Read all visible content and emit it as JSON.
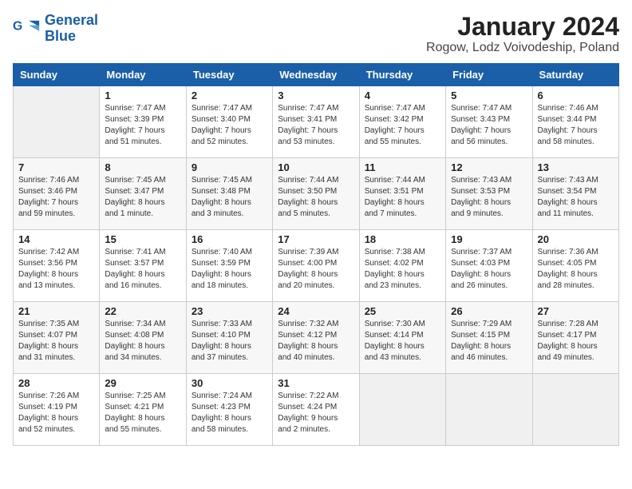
{
  "logo": {
    "line1": "General",
    "line2": "Blue"
  },
  "title": "January 2024",
  "subtitle": "Rogow, Lodz Voivodeship, Poland",
  "days_of_week": [
    "Sunday",
    "Monday",
    "Tuesday",
    "Wednesday",
    "Thursday",
    "Friday",
    "Saturday"
  ],
  "weeks": [
    [
      {
        "day": "",
        "info": ""
      },
      {
        "day": "1",
        "info": "Sunrise: 7:47 AM\nSunset: 3:39 PM\nDaylight: 7 hours\nand 51 minutes."
      },
      {
        "day": "2",
        "info": "Sunrise: 7:47 AM\nSunset: 3:40 PM\nDaylight: 7 hours\nand 52 minutes."
      },
      {
        "day": "3",
        "info": "Sunrise: 7:47 AM\nSunset: 3:41 PM\nDaylight: 7 hours\nand 53 minutes."
      },
      {
        "day": "4",
        "info": "Sunrise: 7:47 AM\nSunset: 3:42 PM\nDaylight: 7 hours\nand 55 minutes."
      },
      {
        "day": "5",
        "info": "Sunrise: 7:47 AM\nSunset: 3:43 PM\nDaylight: 7 hours\nand 56 minutes."
      },
      {
        "day": "6",
        "info": "Sunrise: 7:46 AM\nSunset: 3:44 PM\nDaylight: 7 hours\nand 58 minutes."
      }
    ],
    [
      {
        "day": "7",
        "info": "Sunrise: 7:46 AM\nSunset: 3:46 PM\nDaylight: 7 hours\nand 59 minutes."
      },
      {
        "day": "8",
        "info": "Sunrise: 7:45 AM\nSunset: 3:47 PM\nDaylight: 8 hours\nand 1 minute."
      },
      {
        "day": "9",
        "info": "Sunrise: 7:45 AM\nSunset: 3:48 PM\nDaylight: 8 hours\nand 3 minutes."
      },
      {
        "day": "10",
        "info": "Sunrise: 7:44 AM\nSunset: 3:50 PM\nDaylight: 8 hours\nand 5 minutes."
      },
      {
        "day": "11",
        "info": "Sunrise: 7:44 AM\nSunset: 3:51 PM\nDaylight: 8 hours\nand 7 minutes."
      },
      {
        "day": "12",
        "info": "Sunrise: 7:43 AM\nSunset: 3:53 PM\nDaylight: 8 hours\nand 9 minutes."
      },
      {
        "day": "13",
        "info": "Sunrise: 7:43 AM\nSunset: 3:54 PM\nDaylight: 8 hours\nand 11 minutes."
      }
    ],
    [
      {
        "day": "14",
        "info": "Sunrise: 7:42 AM\nSunset: 3:56 PM\nDaylight: 8 hours\nand 13 minutes."
      },
      {
        "day": "15",
        "info": "Sunrise: 7:41 AM\nSunset: 3:57 PM\nDaylight: 8 hours\nand 16 minutes."
      },
      {
        "day": "16",
        "info": "Sunrise: 7:40 AM\nSunset: 3:59 PM\nDaylight: 8 hours\nand 18 minutes."
      },
      {
        "day": "17",
        "info": "Sunrise: 7:39 AM\nSunset: 4:00 PM\nDaylight: 8 hours\nand 20 minutes."
      },
      {
        "day": "18",
        "info": "Sunrise: 7:38 AM\nSunset: 4:02 PM\nDaylight: 8 hours\nand 23 minutes."
      },
      {
        "day": "19",
        "info": "Sunrise: 7:37 AM\nSunset: 4:03 PM\nDaylight: 8 hours\nand 26 minutes."
      },
      {
        "day": "20",
        "info": "Sunrise: 7:36 AM\nSunset: 4:05 PM\nDaylight: 8 hours\nand 28 minutes."
      }
    ],
    [
      {
        "day": "21",
        "info": "Sunrise: 7:35 AM\nSunset: 4:07 PM\nDaylight: 8 hours\nand 31 minutes."
      },
      {
        "day": "22",
        "info": "Sunrise: 7:34 AM\nSunset: 4:08 PM\nDaylight: 8 hours\nand 34 minutes."
      },
      {
        "day": "23",
        "info": "Sunrise: 7:33 AM\nSunset: 4:10 PM\nDaylight: 8 hours\nand 37 minutes."
      },
      {
        "day": "24",
        "info": "Sunrise: 7:32 AM\nSunset: 4:12 PM\nDaylight: 8 hours\nand 40 minutes."
      },
      {
        "day": "25",
        "info": "Sunrise: 7:30 AM\nSunset: 4:14 PM\nDaylight: 8 hours\nand 43 minutes."
      },
      {
        "day": "26",
        "info": "Sunrise: 7:29 AM\nSunset: 4:15 PM\nDaylight: 8 hours\nand 46 minutes."
      },
      {
        "day": "27",
        "info": "Sunrise: 7:28 AM\nSunset: 4:17 PM\nDaylight: 8 hours\nand 49 minutes."
      }
    ],
    [
      {
        "day": "28",
        "info": "Sunrise: 7:26 AM\nSunset: 4:19 PM\nDaylight: 8 hours\nand 52 minutes."
      },
      {
        "day": "29",
        "info": "Sunrise: 7:25 AM\nSunset: 4:21 PM\nDaylight: 8 hours\nand 55 minutes."
      },
      {
        "day": "30",
        "info": "Sunrise: 7:24 AM\nSunset: 4:23 PM\nDaylight: 8 hours\nand 58 minutes."
      },
      {
        "day": "31",
        "info": "Sunrise: 7:22 AM\nSunset: 4:24 PM\nDaylight: 9 hours\nand 2 minutes."
      },
      {
        "day": "",
        "info": ""
      },
      {
        "day": "",
        "info": ""
      },
      {
        "day": "",
        "info": ""
      }
    ]
  ]
}
